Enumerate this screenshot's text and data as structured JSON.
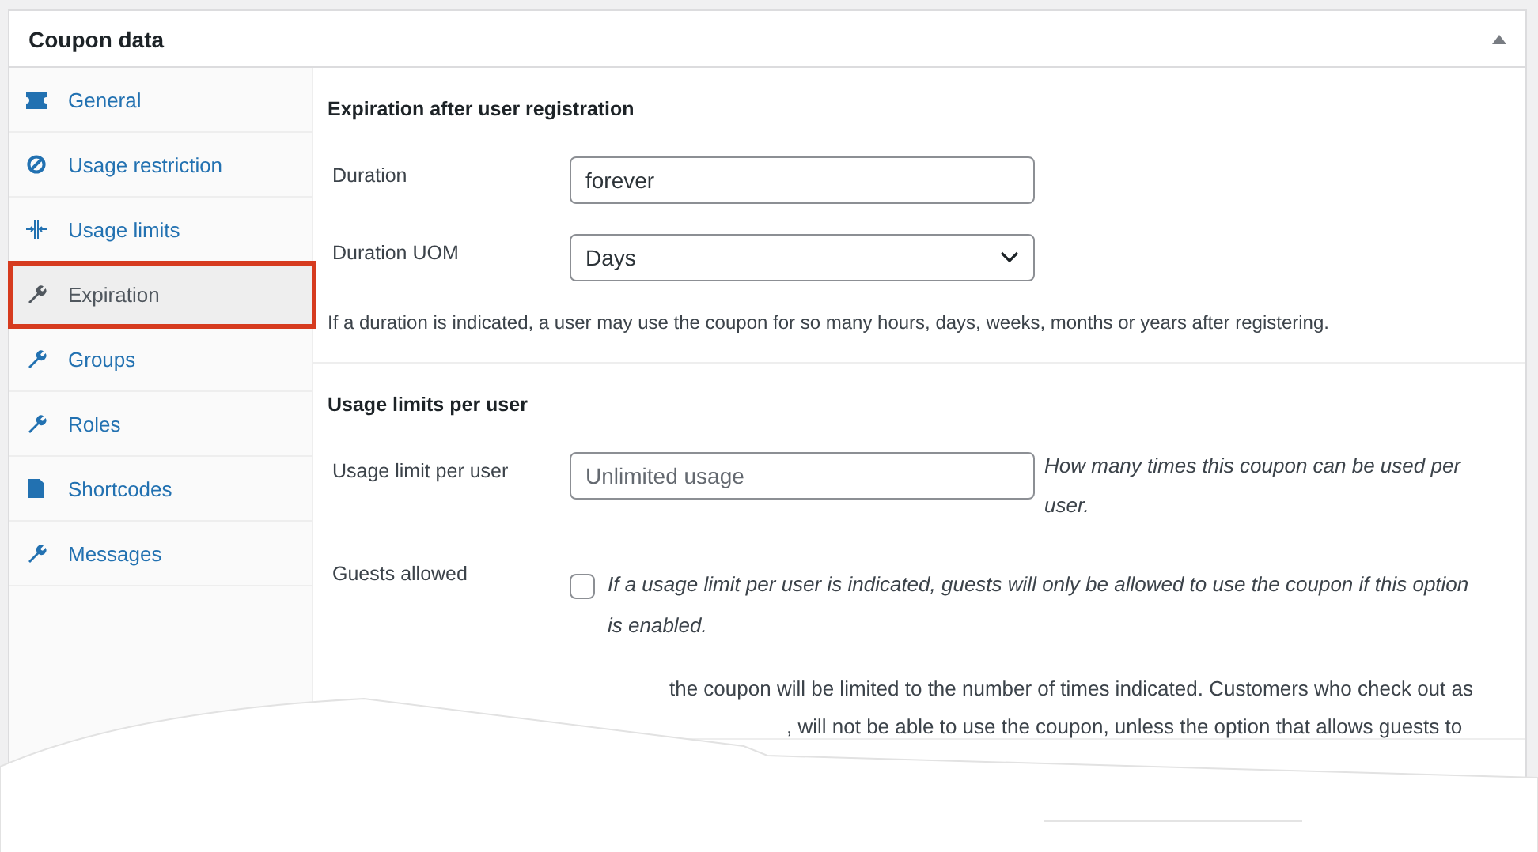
{
  "panel": {
    "title": "Coupon data",
    "collapsed": false
  },
  "tabs": [
    {
      "label": "General",
      "selected": false
    },
    {
      "label": "Usage restriction",
      "selected": false
    },
    {
      "label": "Usage limits",
      "selected": false
    },
    {
      "label": "Expiration",
      "selected": true
    },
    {
      "label": "Groups",
      "selected": false
    },
    {
      "label": "Roles",
      "selected": false
    },
    {
      "label": "Shortcodes",
      "selected": false
    },
    {
      "label": "Messages",
      "selected": false
    }
  ],
  "sections": [
    {
      "heading": "Expiration after user registration",
      "fields": [
        {
          "kind": "text",
          "label": "Duration",
          "value": "forever"
        },
        {
          "kind": "select",
          "label": "Duration UOM",
          "value": "Days"
        }
      ],
      "note": "If a duration is indicated, a user may use the coupon for so many hours, days, weeks, months or years after registering."
    },
    {
      "heading": "Usage limits per user",
      "fields": [
        {
          "kind": "text",
          "label": "Usage limit per user",
          "placeholder": "Unlimited usage",
          "help": "How many times this coupon can be used per user."
        },
        {
          "kind": "checkbox",
          "label": "Guests allowed",
          "checked": false,
          "help": "If a usage limit per user is indicated, guests will only be allowed to use the coupon if this option is enabled."
        }
      ],
      "note_lines": [
        "the coupon will be limited to the number of times indicated. Customers who check out as",
        ", will not be able to use the coupon, unless the option that allows guests to"
      ]
    }
  ]
}
